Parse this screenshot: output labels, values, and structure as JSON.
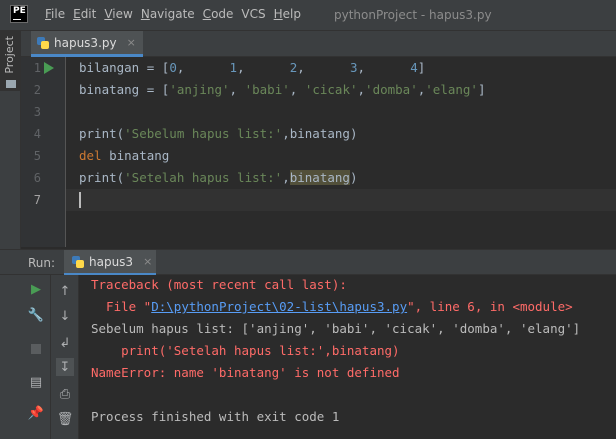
{
  "window": {
    "logo_text": "PE",
    "title": "pythonProject - hapus3.py",
    "menu": [
      {
        "mnemonic": "F",
        "rest": "ile"
      },
      {
        "mnemonic": "E",
        "rest": "dit"
      },
      {
        "mnemonic": "V",
        "rest": "iew"
      },
      {
        "mnemonic": "N",
        "rest": "avigate"
      },
      {
        "mnemonic": "C",
        "rest": "ode"
      },
      {
        "mnemonic": "",
        "rest": "VCS"
      },
      {
        "mnemonic": "H",
        "rest": "elp"
      }
    ]
  },
  "sidebar": {
    "project_label": "Project"
  },
  "editor": {
    "tab": {
      "label": "hapus3.py",
      "close": "×"
    },
    "line_numbers": [
      "1",
      "2",
      "3",
      "4",
      "5",
      "6",
      "7"
    ],
    "lines": {
      "l1": {
        "var": "bilangan",
        "op": " = [",
        "n0": "0",
        "c0": ",",
        "n1": "1",
        "c1": ",",
        "n2": "2",
        "c2": ",",
        "n3": "3",
        "c3": ",",
        "n4": "4",
        "end": "]"
      },
      "l2": {
        "var": "binatang",
        "op": " = [",
        "s0": "'anjing'",
        "c0": ", ",
        "s1": "'babi'",
        "c1": ", ",
        "s2": "'cicak'",
        "c2": ",",
        "s3": "'domba'",
        "c3": ",",
        "s4": "'elang'",
        "end": "]"
      },
      "l4": {
        "fn": "print(",
        "s": "'Sebelum hapus list:'",
        "c": ",",
        "arg": "binatang",
        "end": ")"
      },
      "l5": {
        "kw": "del",
        "arg": " binatang"
      },
      "l6": {
        "fn": "print(",
        "s": "'Setelah hapus list:'",
        "c": ",",
        "arg": "binatang",
        "end": ")"
      }
    }
  },
  "run": {
    "label": "Run:",
    "tab_label": "hapus3",
    "close": "×",
    "console": {
      "traceback": "Traceback (most recent call last):",
      "file_pre": "  File \"",
      "file_link": "D:\\pythonProject\\02-list\\hapus3.py",
      "file_post": "\", line 6, in <module>",
      "before_output": "Sebelum hapus list: ['anjing', 'babi', 'cicak', 'domba', 'elang']",
      "error_code": "    print('Setelah hapus list:',binatang)",
      "error_msg": "NameError: name 'binatang' is not defined",
      "finished": "Process finished with exit code 1"
    }
  },
  "colors": {
    "keyword": "#cc7832",
    "string": "#6a8759",
    "number": "#6897bb",
    "error": "#ff6b68",
    "link": "#589df6",
    "run_green": "#499c54"
  }
}
